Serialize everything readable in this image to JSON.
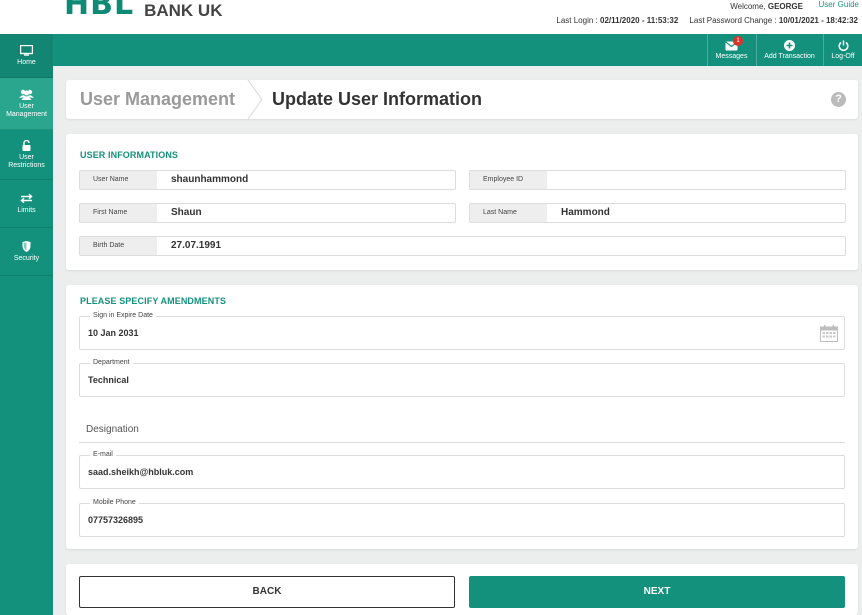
{
  "header": {
    "logo_main": "HBL",
    "logo_sub": "BANK UK",
    "welcome_prefix": "Welcome,",
    "welcome_user": "GEORGE",
    "user_guide": "User Guide",
    "last_login_label": "Last Login :",
    "last_login_value": "02/11/2020 - 11:53:32",
    "last_pw_label": "Last Password Change :",
    "last_pw_value": "10/01/2021 - 18:42:32"
  },
  "nav": {
    "messages_label": "Messages",
    "messages_badge": "1",
    "add_transaction_label": "Add Transaction",
    "logoff_label": "Log-Off"
  },
  "sidebar": {
    "items": [
      {
        "label": "Home",
        "icon": "monitor-icon"
      },
      {
        "label": "User Management",
        "icon": "users-icon"
      },
      {
        "label": "User Restrictions",
        "icon": "lock-icon"
      },
      {
        "label": "Limits",
        "icon": "arrows-icon"
      },
      {
        "label": "Security",
        "icon": "shield-icon"
      }
    ]
  },
  "breadcrumb": {
    "parent": "User Management",
    "current": "Update User Information",
    "help": "?"
  },
  "user_info": {
    "title": "USER INFORMATIONS",
    "username_label": "User Name",
    "username_value": "shaunhammond",
    "employee_id_label": "Employee ID",
    "employee_id_value": "",
    "first_name_label": "First Name",
    "first_name_value": "Shaun",
    "last_name_label": "Last Name",
    "last_name_value": "Hammond",
    "birth_date_label": "Birth Date",
    "birth_date_value": "27.07.1991"
  },
  "amendments": {
    "title": "PLEASE SPECIFY AMENDMENTS",
    "expire_label": "Sign in Expire Date",
    "expire_value": "10 Jan 2031",
    "department_label": "Department",
    "department_value": "Technical",
    "designation_label": "Designation",
    "email_label": "E-mail",
    "email_value": "saad.sheikh@hbluk.com",
    "mobile_label": "Mobile Phone",
    "mobile_value": "07757326895"
  },
  "buttons": {
    "back": "BACK",
    "next": "NEXT"
  },
  "colors": {
    "brand": "#14917c",
    "badge": "#d9342b"
  }
}
